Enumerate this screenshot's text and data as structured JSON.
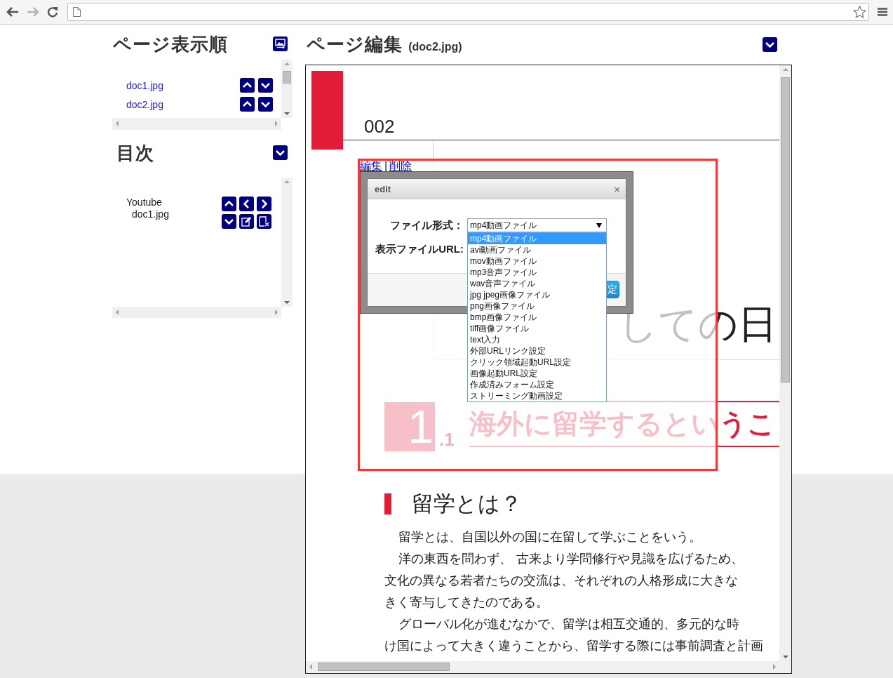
{
  "browser": {
    "back": {
      "disabled": false
    },
    "forward": {
      "disabled": true
    },
    "bookmarked": false
  },
  "page_order": {
    "title": "ページ表示順",
    "items": [
      {
        "label": "doc1.jpg"
      },
      {
        "label": "doc2.jpg"
      }
    ]
  },
  "toc": {
    "title": "目次",
    "entries": [
      {
        "label": "Youtube",
        "children": [
          {
            "label": "doc1.jpg"
          }
        ]
      }
    ]
  },
  "editor": {
    "title": "ページ編集",
    "file": "(doc2.jpg)",
    "document": {
      "page_number": "002",
      "banner": "しての日",
      "section_number": "1",
      "section_sub": ".1",
      "section_title": "海外に留学するというこ",
      "heading": "留学とは？",
      "lines": [
        {
          "text": "留学とは、自国以外の国に在留して学ぶことをいう。",
          "indent": true
        },
        {
          "text": "洋の東西を問わず、 古来より学問修行や見識を広げるため、",
          "indent": true
        },
        {
          "text": "文化の異なる若者たちの交流は、それぞれの人格形成に大きな",
          "indent": false
        },
        {
          "text": "きく寄与してきたのである。",
          "indent": false
        },
        {
          "text": "グローバル化が進むなかで、留学は相互交通的、多元的な時",
          "indent": true
        },
        {
          "text": "け国によって大きく違うことから、留学する際には事前調査と計画",
          "indent": false
        }
      ]
    },
    "region": {
      "links": [
        {
          "label": "編集"
        },
        {
          "label": "削除"
        }
      ],
      "separator": "|"
    },
    "dialog": {
      "title": "edit",
      "close": "×",
      "fields": [
        {
          "kind": "select",
          "label": "ファイル形式：",
          "value": "mp4動画ファイル"
        },
        {
          "kind": "text",
          "label": "表示ファイルURL:"
        }
      ],
      "options": [
        {
          "label": "mp4動画ファイル",
          "selected": true
        },
        {
          "label": "avi動画ファイル",
          "selected": false
        },
        {
          "label": "mov動画ファイル",
          "selected": false
        },
        {
          "label": "mp3音声ファイル",
          "selected": false
        },
        {
          "label": "wav音声ファイル",
          "selected": false
        },
        {
          "label": "jpg jpeg画像ファイル",
          "selected": false
        },
        {
          "label": "png画像ファイル",
          "selected": false
        },
        {
          "label": "bmp画像ファイル",
          "selected": false
        },
        {
          "label": "tiff画像ファイル",
          "selected": false
        },
        {
          "label": "text入力",
          "selected": false
        },
        {
          "label": "外部URLリンク設定",
          "selected": false
        },
        {
          "label": "クリック領域起動URL設定",
          "selected": false
        },
        {
          "label": "画像起動URL設定",
          "selected": false
        },
        {
          "label": "作成済みフォーム設定",
          "selected": false
        },
        {
          "label": "ストリーミング動画設定",
          "selected": false
        }
      ],
      "button": "定"
    }
  }
}
